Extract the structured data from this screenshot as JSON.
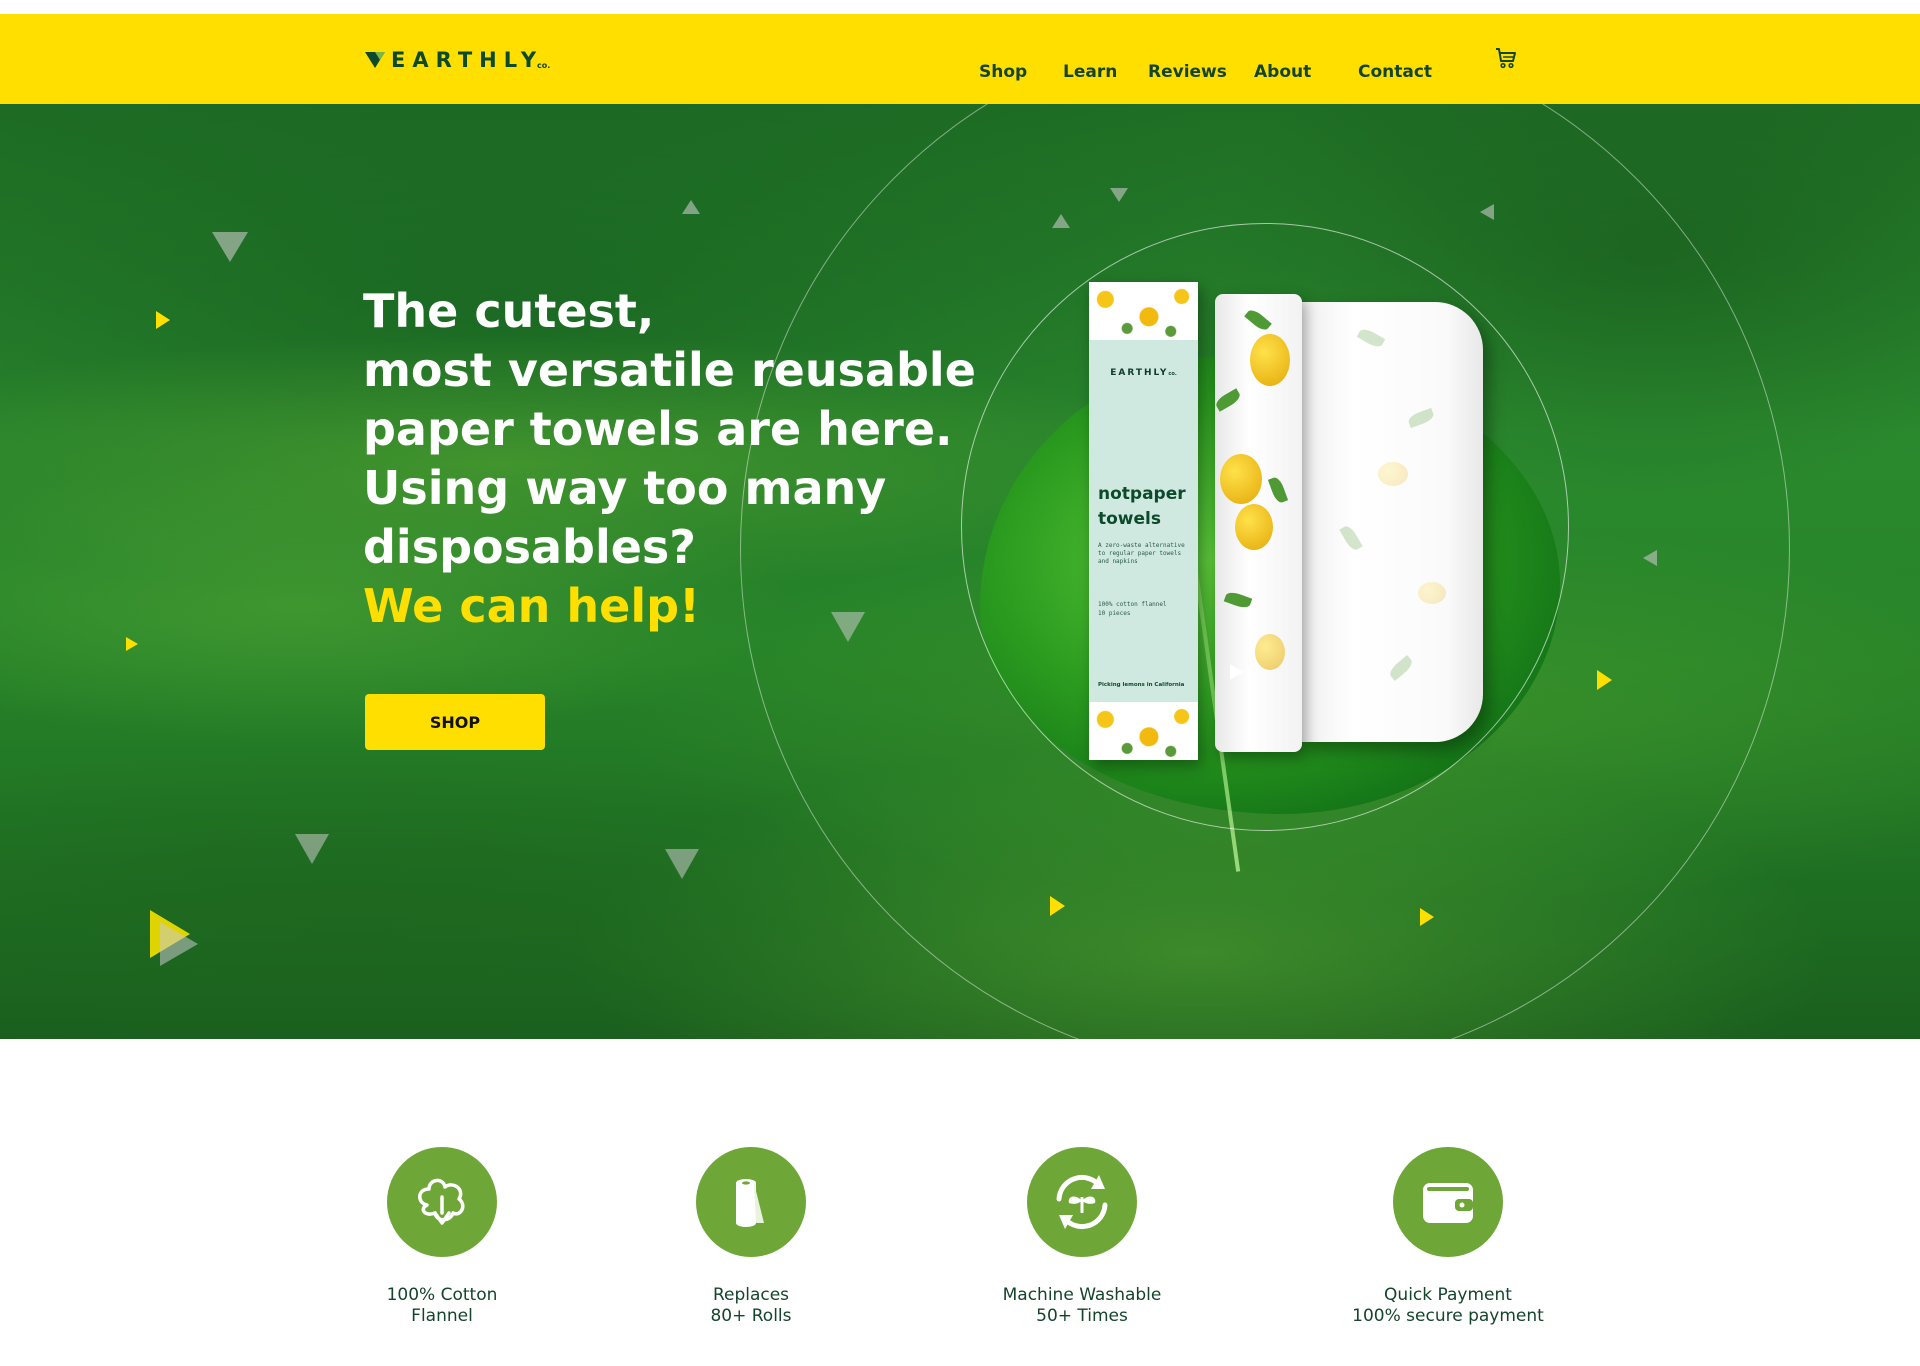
{
  "brand": {
    "name": "EARTHLY",
    "suffix": "co."
  },
  "nav": {
    "links": [
      "Shop",
      "Learn",
      "Reviews",
      "About",
      "Contact"
    ],
    "cart_icon": "cart-icon"
  },
  "hero": {
    "heading_lines": [
      "The cutest,",
      "most versatile reusable",
      "paper towels are here.",
      "Using way too many",
      "disposables?"
    ],
    "accent_line": "We can help!",
    "cta_label": "SHOP",
    "product": {
      "brand": "EARTHLY",
      "brand_suffix": "co.",
      "title_line1": "notpaper",
      "title_line2": "towels",
      "description": "A zero-waste alternative to regular paper towels and napkins",
      "spec_line1": "100% cotton flannel",
      "spec_line2": "10 pieces",
      "footer": "Picking lemons in California"
    }
  },
  "features": [
    {
      "icon": "cotton-icon",
      "line1": "100% Cotton",
      "line2": "Flannel"
    },
    {
      "icon": "paper-roll-icon",
      "line1": "Replaces",
      "line2": "80+ Rolls"
    },
    {
      "icon": "recycle-leaf-icon",
      "line1": "Machine Washable",
      "line2": "50+ Times"
    },
    {
      "icon": "wallet-icon",
      "line1": "Quick Payment",
      "line2": "100% secure payment"
    }
  ],
  "colors": {
    "accent_yellow": "#ffdf00",
    "dark_green": "#14452c",
    "icon_green": "#6ea638",
    "hero_green": "#268228"
  }
}
